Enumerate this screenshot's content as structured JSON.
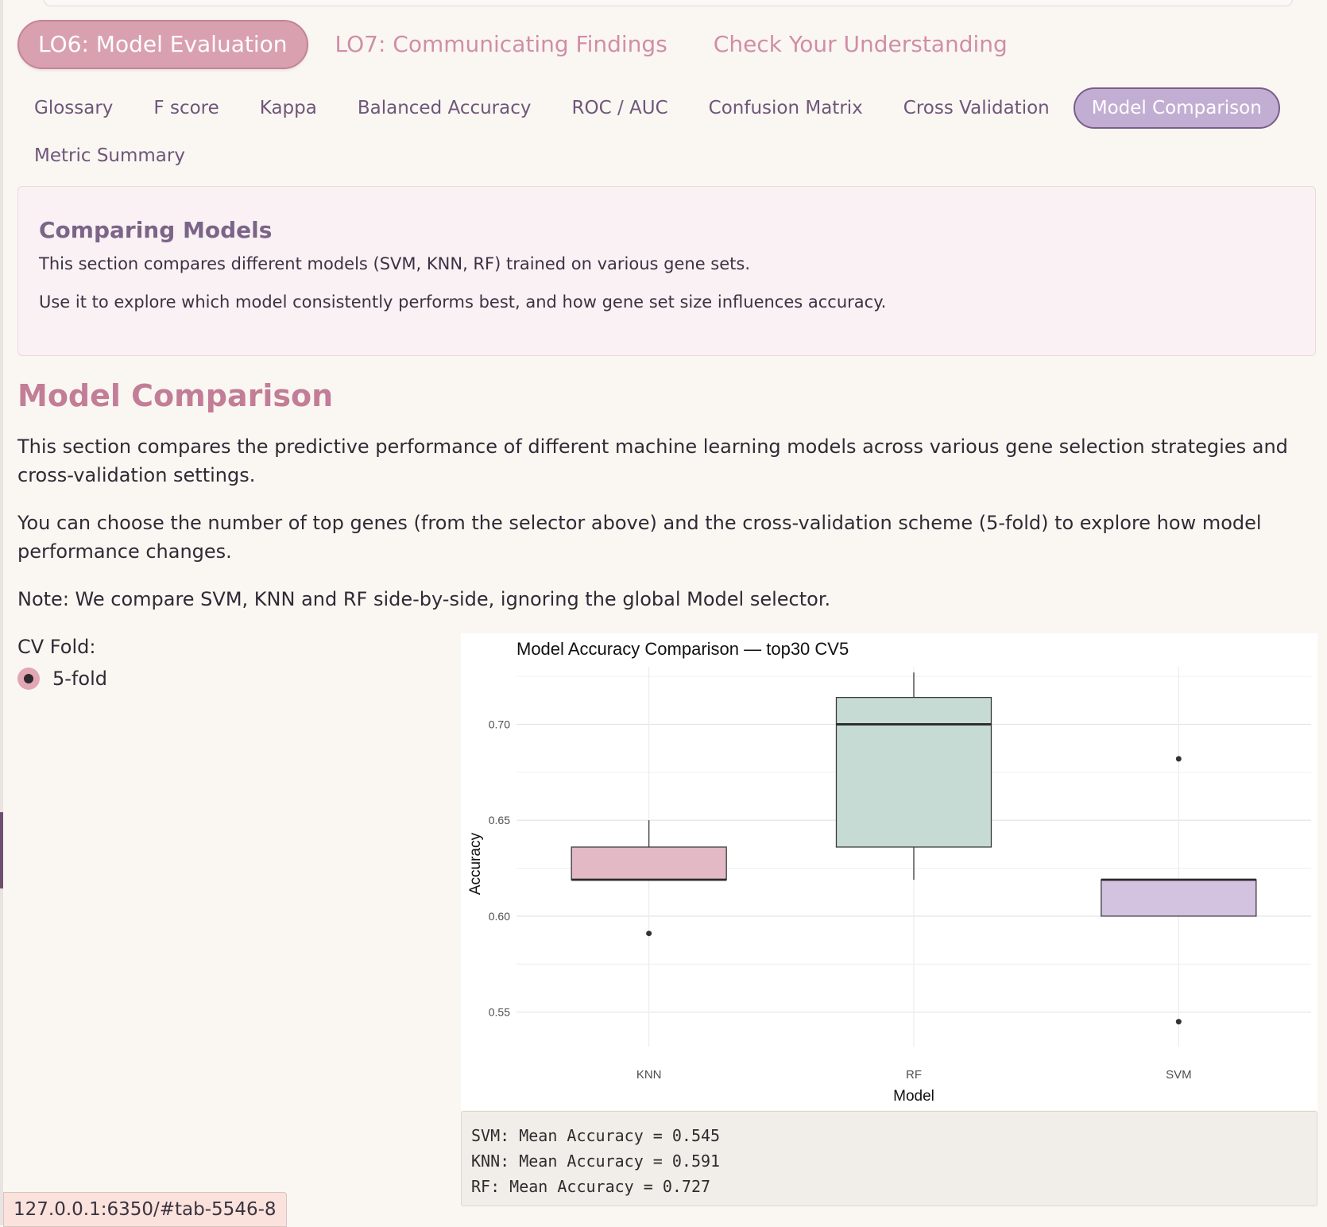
{
  "lo_tabs": [
    {
      "label": "LO6: Model Evaluation",
      "active": true
    },
    {
      "label": "LO7: Communicating Findings",
      "active": false
    },
    {
      "label": "Check Your Understanding",
      "active": false
    }
  ],
  "sub_tabs": [
    {
      "label": "Glossary",
      "active": false
    },
    {
      "label": "F score",
      "active": false
    },
    {
      "label": "Kappa",
      "active": false
    },
    {
      "label": "Balanced Accuracy",
      "active": false
    },
    {
      "label": "ROC / AUC",
      "active": false
    },
    {
      "label": "Confusion Matrix",
      "active": false
    },
    {
      "label": "Cross Validation",
      "active": false
    },
    {
      "label": "Model Comparison",
      "active": true
    },
    {
      "label": "Metric Summary",
      "active": false
    }
  ],
  "info_box": {
    "title": "Comparing Models",
    "line1": "This section compares different models (SVM, KNN, RF) trained on various gene sets.",
    "line2": "Use it to explore which model consistently performs best, and how gene set size influences accuracy."
  },
  "section": {
    "title": "Model Comparison",
    "para1": "This section compares the predictive performance of different machine learning models across various gene selection strategies and cross-validation settings.",
    "para2": "You can choose the number of top genes (from the selector above) and the cross-validation scheme (5-fold) to explore how model performance changes.",
    "para3": "Note: We compare SVM, KNN and RF side-by-side, ignoring the global Model selector."
  },
  "cv_fold": {
    "label": "CV Fold:",
    "options": [
      {
        "label": "5-fold",
        "selected": true
      }
    ]
  },
  "chart_data": {
    "type": "boxplot",
    "title": "Model Accuracy Comparison — top30 CV5",
    "xlabel": "Model",
    "ylabel": "Accuracy",
    "ylim": [
      0.532,
      0.73
    ],
    "yticks": [
      "0.55",
      "0.60",
      "0.65",
      "0.70"
    ],
    "grid": true,
    "categories": [
      "KNN",
      "RF",
      "SVM"
    ],
    "boxes": [
      {
        "category": "KNN",
        "whisker_low": 0.619,
        "q1": 0.619,
        "median": 0.619,
        "q3": 0.636,
        "whisker_high": 0.65,
        "outliers": [
          0.591
        ],
        "color": "#e3b9c5"
      },
      {
        "category": "RF",
        "whisker_low": 0.619,
        "q1": 0.636,
        "median": 0.7,
        "q3": 0.714,
        "whisker_high": 0.727,
        "outliers": [],
        "color": "#c6dbd3"
      },
      {
        "category": "SVM",
        "whisker_low": 0.6,
        "q1": 0.6,
        "median": 0.619,
        "q3": 0.619,
        "whisker_high": 0.619,
        "outliers": [
          0.682,
          0.545
        ],
        "color": "#d4c3e0"
      }
    ]
  },
  "output": {
    "lines": [
      "SVM: Mean Accuracy = 0.545",
      "KNN: Mean Accuracy = 0.591",
      "RF: Mean Accuracy = 0.727"
    ]
  },
  "status_bar": {
    "url": "127.0.0.1:6350/#tab-5546-8"
  }
}
